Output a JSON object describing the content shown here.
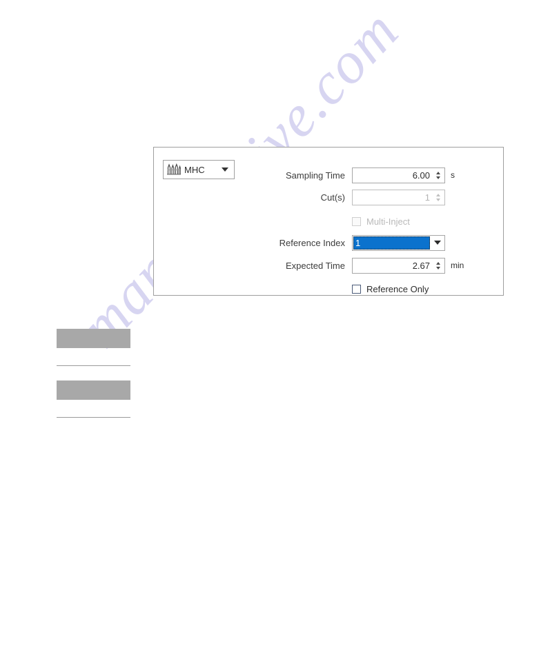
{
  "watermark": {
    "text": "manualshive.com"
  },
  "panel": {
    "device_selector": {
      "icon": "chromatogram-peaks-icon",
      "value": "MHC",
      "caret": "chevron-down-icon"
    },
    "rows": {
      "sampling_time": {
        "label": "Sampling Time",
        "value": "6.00",
        "unit": "s"
      },
      "cuts": {
        "label": "Cut(s)",
        "value": "1",
        "unit": ""
      },
      "multi_inject": {
        "label": "Multi-Inject",
        "checked": false,
        "enabled": false
      },
      "reference_index": {
        "label": "Reference Index",
        "value": "1",
        "options": [
          "1"
        ],
        "selected": true
      },
      "expected_time": {
        "label": "Expected Time",
        "value": "2.67",
        "unit": "min"
      },
      "reference_only": {
        "label": "Reference Only",
        "checked": false,
        "enabled": true
      }
    }
  },
  "colors": {
    "selection_blue": "#0b72cd",
    "panel_border": "#9e9e9e",
    "redaction_gray": "#a8a8a8",
    "watermark": "#c9c6ec"
  }
}
